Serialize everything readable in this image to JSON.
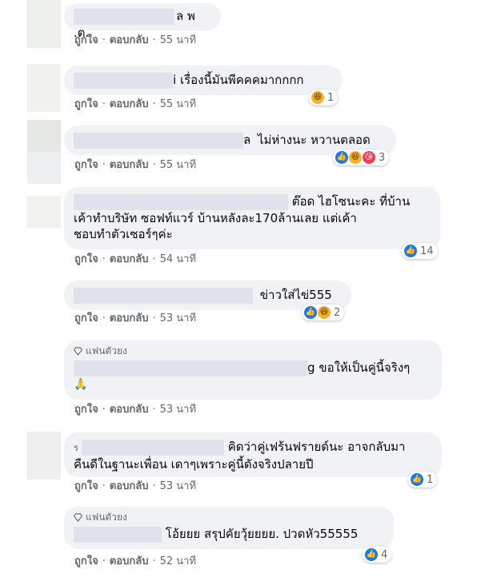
{
  "comments": [
    {
      "author_suffix": "ล พ .ต.",
      "text": "",
      "reaction_count": "",
      "reactions": [],
      "like_label": "ถูกใจ",
      "reply_label": "ตอบกลับ",
      "time": "55 นาที"
    },
    {
      "author_suffix": "i",
      "text": "เรื่องนี้มันพีคคคมากกกก",
      "reaction_count": "1",
      "reactions": [
        "haha"
      ],
      "like_label": "ถูกใจ",
      "reply_label": "ตอบกลับ",
      "time": "55 นาที"
    },
    {
      "author_suffix": "ล",
      "text": "ไม่ห่างนะ หวานตลอด",
      "reaction_count": "3",
      "reactions": [
        "like",
        "haha",
        "love"
      ],
      "like_label": "ถูกใจ",
      "reply_label": "ตอบกลับ",
      "time": "55 นาที"
    },
    {
      "author_suffix": "",
      "text_line1": "ต๊อด ไฮโซนะคะ ที่บ้าน",
      "text_line2": "เค้าทำบริษัท ซอฟท์แวร์ บ้านหลังละ170ล้านเลย แต่เค้า",
      "text_line3": "ชอบทำตัวเซอร์ๆค่ะ",
      "reaction_count": "14",
      "reactions": [
        "like"
      ],
      "like_label": "ถูกใจ",
      "reply_label": "ตอบกลับ",
      "time": "54 นาที"
    },
    {
      "author_suffix": "",
      "text": "ข่าวใส่ไข่555",
      "reaction_count": "2",
      "reactions": [
        "like",
        "haha"
      ],
      "like_label": "ถูกใจ",
      "reply_label": "ตอบกลับ",
      "time": "53 นาที"
    },
    {
      "badge": "แฟนตัวยง",
      "author_suffix": "g",
      "text": "ขอให้เป็นคู่นี้จริงๆ",
      "emoji_line": "🙏",
      "reaction_count": "",
      "reactions": [],
      "like_label": "ถูกใจ",
      "reply_label": "ตอบกลับ",
      "time": "53 นาที"
    },
    {
      "author_prefix": "ร",
      "text_line1": "คิดว่าคู่เฟร้นฟรายด์นะ อาจกลับมา",
      "text_line2": "คืนดีในฐานะเพื่อน เดาๆเพราะคู่นี้ดังจริงปลายปี",
      "reaction_count": "1",
      "reactions": [
        "like"
      ],
      "like_label": "ถูกใจ",
      "reply_label": "ตอบกลับ",
      "time": "53 นาที"
    },
    {
      "badge": "แฟนตัวยง",
      "author_suffix": "",
      "text": "โอ้ยยย สรุปคัยวุ้ยยยย. ปวดหัว55555",
      "reaction_count": "4",
      "reactions": [
        "like"
      ],
      "like_label": "ถูกใจ",
      "reply_label": "ตอบกลับ",
      "time": "52 นาที"
    }
  ],
  "colors": {
    "bubble": "#f0f2f5",
    "meta": "#65676b",
    "text": "#050505",
    "like": "#1877f2"
  }
}
